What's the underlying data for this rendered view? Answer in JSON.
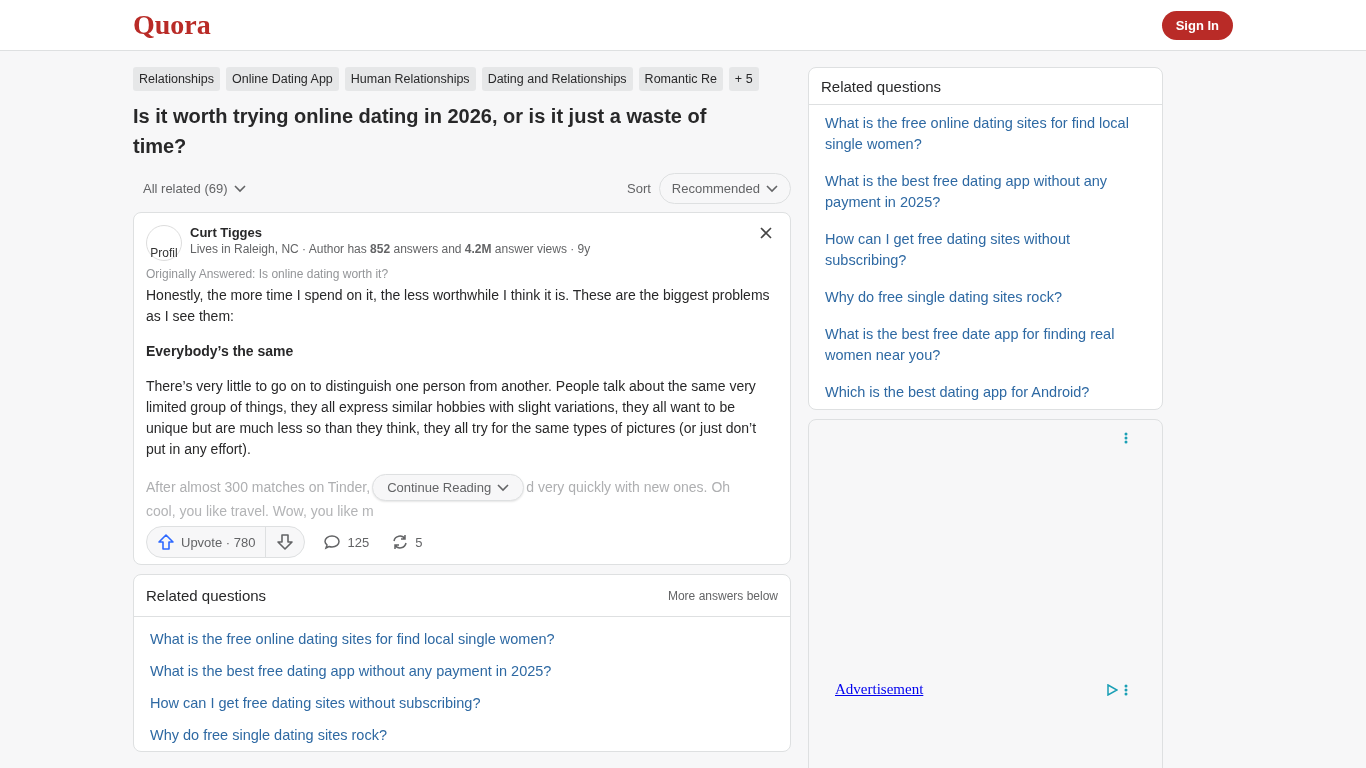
{
  "header": {
    "logo": "Quora",
    "sign_in": "Sign In"
  },
  "topics": [
    "Relationships",
    "Online Dating App",
    "Human Relationships",
    "Dating and Relationships",
    "Romantic Re",
    "+ 5"
  ],
  "question": "Is it worth trying online dating in 2026, or is it just a waste of time?",
  "filter": {
    "label": "All related (69)",
    "sort_label": "Sort",
    "sort_value": "Recommended"
  },
  "answer": {
    "avatar_alt": "Profil",
    "author": "Curt Tigges",
    "credentials": "Lives in Raleigh, NC · Author has **852** answers and **4.2M** answer views · 9y",
    "originally": "Originally Answered: Is online dating worth it?",
    "paragraphs": [
      {
        "kind": "text",
        "text": "Honestly, the more time I spend on it, the less worthwhile I think it is. These are the biggest problems as I see them:"
      },
      {
        "kind": "heading",
        "text": "Everybody’s the same"
      },
      {
        "kind": "text",
        "text": "There’s very little to go on to distinguish one person from another. People talk about the same very limited group of things, they all express similar hobbies with slight variations, they all want to be unique but are much less so than they think, they all try for the same types of pictures (or just don’t put in any effort)."
      }
    ],
    "faded_left": "After almost 300 matches on Tinder,",
    "faded_right": "d very quickly with new ones. Oh",
    "faded_line2": "cool, you like travel. Wow, you like m",
    "continue": "Continue Reading",
    "upvote": "Upvote · 780",
    "comments": "125",
    "shares": "5"
  },
  "related_inline": {
    "title": "Related questions",
    "more": "More answers below",
    "items": [
      "What is the free online dating sites for find local single women?",
      "What is the best free dating app without any payment in 2025?",
      "How can I get free dating sites without subscribing?",
      "Why do free single dating sites rock?"
    ]
  },
  "sidebar": {
    "title": "Related questions",
    "items": [
      "What is the free online dating sites for find local single women?",
      "What is the best free dating app without any payment in 2025?",
      "How can I get free dating sites without subscribing?",
      "Why do free single dating sites rock?",
      "What is the best free date app for finding real women near you?",
      "Which is the best dating app for Android?"
    ]
  },
  "ad": {
    "label": "Advertisement"
  }
}
